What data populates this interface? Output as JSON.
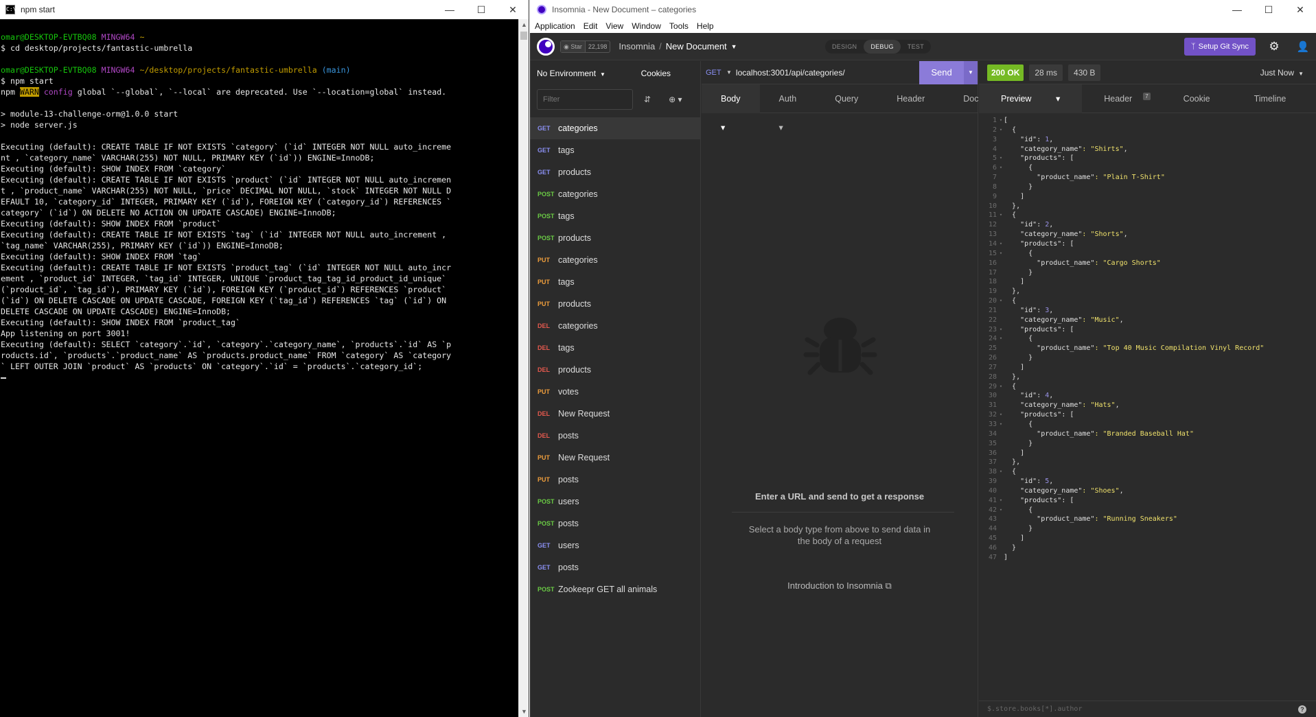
{
  "terminal": {
    "title": "npm start",
    "icon": "terminal-icon",
    "lines": [
      [
        {
          "t": "omar@DESKTOP-EVTBQ08",
          "c": "c-green"
        },
        {
          "t": " "
        },
        {
          "t": "MINGW64",
          "c": "c-mag"
        },
        {
          "t": " "
        },
        {
          "t": "~",
          "c": "c-yel"
        }
      ],
      [
        {
          "t": "$ cd desktop/projects/fantastic-umbrella"
        }
      ],
      [
        {
          "t": ""
        }
      ],
      [
        {
          "t": "omar@DESKTOP-EVTBQ08",
          "c": "c-green"
        },
        {
          "t": " "
        },
        {
          "t": "MINGW64",
          "c": "c-mag"
        },
        {
          "t": " "
        },
        {
          "t": "~/desktop/projects/fantastic-umbrella",
          "c": "c-yel"
        },
        {
          "t": " "
        },
        {
          "t": "(main)",
          "c": "c-cyan"
        }
      ],
      [
        {
          "t": "$ npm start"
        }
      ],
      [
        {
          "t": "npm "
        },
        {
          "t": "WARN",
          "c": "c-warn"
        },
        {
          "t": " "
        },
        {
          "t": "config",
          "c": "c-mag"
        },
        {
          "t": " global `--global`, `--local` are deprecated. Use `--location=global` instead."
        }
      ],
      [
        {
          "t": ""
        }
      ],
      [
        {
          "t": "> module-13-challenge-orm@1.0.0 start"
        }
      ],
      [
        {
          "t": "> node server.js"
        }
      ],
      [
        {
          "t": ""
        }
      ],
      [
        {
          "t": "Executing (default): CREATE TABLE IF NOT EXISTS `category` (`id` INTEGER NOT NULL auto_increme"
        }
      ],
      [
        {
          "t": "nt , `category_name` VARCHAR(255) NOT NULL, PRIMARY KEY (`id`)) ENGINE=InnoDB;"
        }
      ],
      [
        {
          "t": "Executing (default): SHOW INDEX FROM `category`"
        }
      ],
      [
        {
          "t": "Executing (default): CREATE TABLE IF NOT EXISTS `product` (`id` INTEGER NOT NULL auto_incremen"
        }
      ],
      [
        {
          "t": "t , `product_name` VARCHAR(255) NOT NULL, `price` DECIMAL NOT NULL, `stock` INTEGER NOT NULL D"
        }
      ],
      [
        {
          "t": "EFAULT 10, `category_id` INTEGER, PRIMARY KEY (`id`), FOREIGN KEY (`category_id`) REFERENCES `"
        }
      ],
      [
        {
          "t": "category` (`id`) ON DELETE NO ACTION ON UPDATE CASCADE) ENGINE=InnoDB;"
        }
      ],
      [
        {
          "t": "Executing (default): SHOW INDEX FROM `product`"
        }
      ],
      [
        {
          "t": "Executing (default): CREATE TABLE IF NOT EXISTS `tag` (`id` INTEGER NOT NULL auto_increment ,"
        }
      ],
      [
        {
          "t": "`tag_name` VARCHAR(255), PRIMARY KEY (`id`)) ENGINE=InnoDB;"
        }
      ],
      [
        {
          "t": "Executing (default): SHOW INDEX FROM `tag`"
        }
      ],
      [
        {
          "t": "Executing (default): CREATE TABLE IF NOT EXISTS `product_tag` (`id` INTEGER NOT NULL auto_incr"
        }
      ],
      [
        {
          "t": "ement , `product_id` INTEGER, `tag_id` INTEGER, UNIQUE `product_tag_tag_id_product_id_unique`"
        }
      ],
      [
        {
          "t": "(`product_id`, `tag_id`), PRIMARY KEY (`id`), FOREIGN KEY (`product_id`) REFERENCES `product`"
        }
      ],
      [
        {
          "t": "(`id`) ON DELETE CASCADE ON UPDATE CASCADE, FOREIGN KEY (`tag_id`) REFERENCES `tag` (`id`) ON"
        }
      ],
      [
        {
          "t": "DELETE CASCADE ON UPDATE CASCADE) ENGINE=InnoDB;"
        }
      ],
      [
        {
          "t": "Executing (default): SHOW INDEX FROM `product_tag`"
        }
      ],
      [
        {
          "t": "App listening on port 3001!"
        }
      ],
      [
        {
          "t": "Executing (default): SELECT `category`.`id`, `category`.`category_name`, `products`.`id` AS `p"
        }
      ],
      [
        {
          "t": "roducts.id`, `products`.`product_name` AS `products.product_name` FROM `category` AS `category"
        }
      ],
      [
        {
          "t": "` LEFT OUTER JOIN `product` AS `products` ON `category`.`id` = `products`.`category_id`;"
        }
      ]
    ]
  },
  "insomnia": {
    "window_title": "Insomnia - New Document – categories",
    "menu": [
      "Application",
      "Edit",
      "View",
      "Window",
      "Tools",
      "Help"
    ],
    "github_star_label": "Star",
    "github_star_count": "22,198",
    "breadcrumb": {
      "root": "Insomnia",
      "sep": "/",
      "current": "New Document"
    },
    "modes": [
      "DESIGN",
      "DEBUG",
      "TEST"
    ],
    "active_mode": "DEBUG",
    "git_sync_label": "Setup Git Sync",
    "environment": "No Environment",
    "cookies_label": "Cookies",
    "filter_placeholder": "Filter",
    "requests": [
      {
        "method": "GET",
        "name": "categories",
        "active": true
      },
      {
        "method": "GET",
        "name": "tags"
      },
      {
        "method": "GET",
        "name": "products"
      },
      {
        "method": "POST",
        "name": "categories"
      },
      {
        "method": "POST",
        "name": "tags"
      },
      {
        "method": "POST",
        "name": "products"
      },
      {
        "method": "PUT",
        "name": "categories"
      },
      {
        "method": "PUT",
        "name": "tags"
      },
      {
        "method": "PUT",
        "name": "products"
      },
      {
        "method": "DEL",
        "name": "categories"
      },
      {
        "method": "DEL",
        "name": "tags"
      },
      {
        "method": "DEL",
        "name": "products"
      },
      {
        "method": "PUT",
        "name": "votes"
      },
      {
        "method": "DEL",
        "name": "New Request"
      },
      {
        "method": "DEL",
        "name": "posts"
      },
      {
        "method": "PUT",
        "name": "New Request"
      },
      {
        "method": "PUT",
        "name": "posts"
      },
      {
        "method": "POST",
        "name": "users"
      },
      {
        "method": "POST",
        "name": "posts"
      },
      {
        "method": "GET",
        "name": "users"
      },
      {
        "method": "GET",
        "name": "posts"
      },
      {
        "method": "POST",
        "name": "Zookeepr GET all animals"
      }
    ],
    "request": {
      "method": "GET",
      "url": "localhost:3001/api/categories/",
      "send_label": "Send",
      "tabs": [
        "Body",
        "Auth",
        "Query",
        "Header",
        "Docs"
      ],
      "empty_title": "Enter a URL and send to get a response",
      "empty_subtitle": "Select a body type from above to send data in the body of a request",
      "intro_link": "Introduction to Insomnia"
    },
    "response": {
      "status": "200 OK",
      "time": "28 ms",
      "size": "430 B",
      "when": "Just Now",
      "tabs": [
        "Preview",
        "Header",
        "Cookie",
        "Timeline"
      ],
      "header_count": "7",
      "filter_placeholder": "$.store.books[*].author",
      "categories": [
        {
          "id": 1,
          "category_name": "Shirts",
          "product_name": "Plain T-Shirt"
        },
        {
          "id": 2,
          "category_name": "Shorts",
          "product_name": "Cargo Shorts"
        },
        {
          "id": 3,
          "category_name": "Music",
          "product_name": "Top 40 Music Compilation Vinyl Record"
        },
        {
          "id": 4,
          "category_name": "Hats",
          "product_name": "Branded Baseball Hat"
        },
        {
          "id": 5,
          "category_name": "Shoes",
          "product_name": "Running Sneakers"
        }
      ]
    }
  }
}
